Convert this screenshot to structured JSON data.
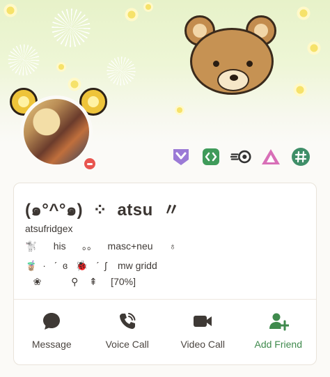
{
  "profile": {
    "display_name": "(๑°^°๑)  ⁘  atsu  〃",
    "username": "atsufridgex",
    "pronouns_line": "🐩      his      。。    masc+neu      ♁",
    "bio_line1": "🧋  ·   ˊ  ɞ   🐞   ˊ  ʃ    mw gridd",
    "bio_line2": "   ❀           ⚲    ⇞     [70%]",
    "status": "dnd"
  },
  "badges": [
    {
      "name": "hypesquad-icon",
      "color": "#9b7ad6"
    },
    {
      "name": "active-developer-icon",
      "color": "#3f9b5a"
    },
    {
      "name": "speed-icon",
      "color": "#333333"
    },
    {
      "name": "triangle-icon",
      "color": "#d86fb7"
    },
    {
      "name": "hashtag-icon",
      "color": "#3f8e68"
    }
  ],
  "actions": [
    {
      "label": "Message",
      "icon": "chat-bubble-icon"
    },
    {
      "label": "Voice Call",
      "icon": "phone-icon"
    },
    {
      "label": "Video Call",
      "icon": "video-camera-icon"
    },
    {
      "label": "Add Friend",
      "icon": "add-friend-icon"
    }
  ],
  "colors": {
    "icon_gray": "#3e3935",
    "add_friend_green": "#3f8a4d",
    "status_dnd": "#e8554f"
  }
}
